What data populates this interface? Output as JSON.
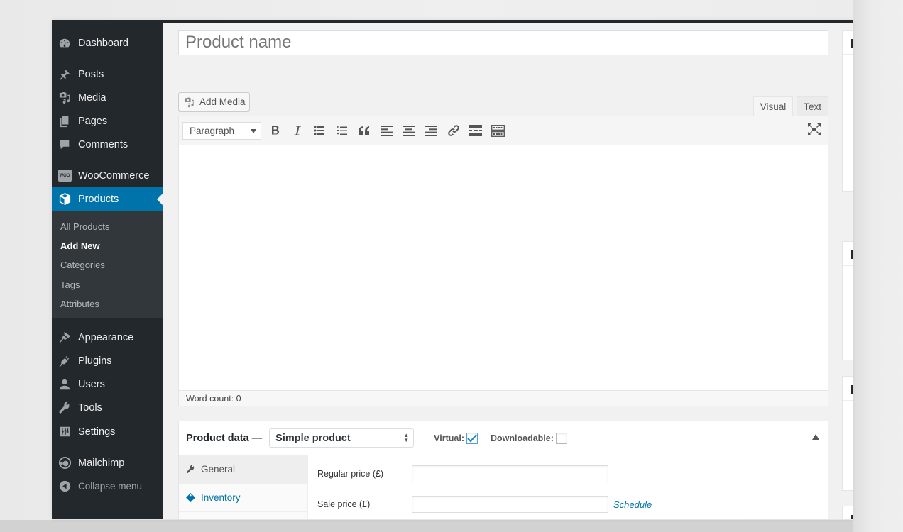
{
  "sidebar": {
    "items": [
      {
        "label": "Dashboard",
        "icon": "dashboard-icon"
      },
      {
        "label": "Posts",
        "icon": "pin-icon"
      },
      {
        "label": "Media",
        "icon": "media-icon"
      },
      {
        "label": "Pages",
        "icon": "pages-icon"
      },
      {
        "label": "Comments",
        "icon": "comment-icon"
      },
      {
        "label": "WooCommerce",
        "icon": "woo-icon"
      },
      {
        "label": "Products",
        "icon": "box-icon",
        "active": true
      },
      {
        "label": "Appearance",
        "icon": "brush-icon"
      },
      {
        "label": "Plugins",
        "icon": "plug-icon"
      },
      {
        "label": "Users",
        "icon": "user-icon"
      },
      {
        "label": "Tools",
        "icon": "wrench-icon"
      },
      {
        "label": "Settings",
        "icon": "sliders-icon"
      },
      {
        "label": "Mailchimp",
        "icon": "mailchimp-icon"
      },
      {
        "label": "Collapse menu",
        "icon": "collapse-icon"
      }
    ],
    "submenu": [
      {
        "label": "All Products"
      },
      {
        "label": "Add New",
        "current": true
      },
      {
        "label": "Categories"
      },
      {
        "label": "Tags"
      },
      {
        "label": "Attributes"
      }
    ],
    "woo_badge": "WOO"
  },
  "editor": {
    "title_placeholder": "Product name",
    "add_media_label": "Add Media",
    "tabs": [
      {
        "label": "Visual",
        "active": true
      },
      {
        "label": "Text"
      }
    ],
    "format_select": "Paragraph",
    "toolbar_buttons": [
      "bold",
      "italic",
      "bulleted-list",
      "numbered-list",
      "blockquote",
      "align-left",
      "align-center",
      "align-right",
      "insert-link",
      "read-more",
      "toolbar-toggle"
    ],
    "word_count": "Word count: 0"
  },
  "product_data": {
    "title": "Product data —",
    "product_type": "Simple product",
    "virtual_label": "Virtual:",
    "virtual_checked": true,
    "downloadable_label": "Downloadable:",
    "downloadable_checked": false,
    "tabs": [
      {
        "label": "General",
        "icon": "wrench-icon",
        "active": true
      },
      {
        "label": "Inventory",
        "icon": "tag-icon"
      }
    ],
    "fields": [
      {
        "label": "Regular price (£)",
        "value": ""
      },
      {
        "label": "Sale price (£)",
        "value": "",
        "link": "Schedule"
      }
    ]
  },
  "colors": {
    "sidebar_bg": "#23282d",
    "active_blue": "#0073aa",
    "link_blue": "#0073aa"
  }
}
